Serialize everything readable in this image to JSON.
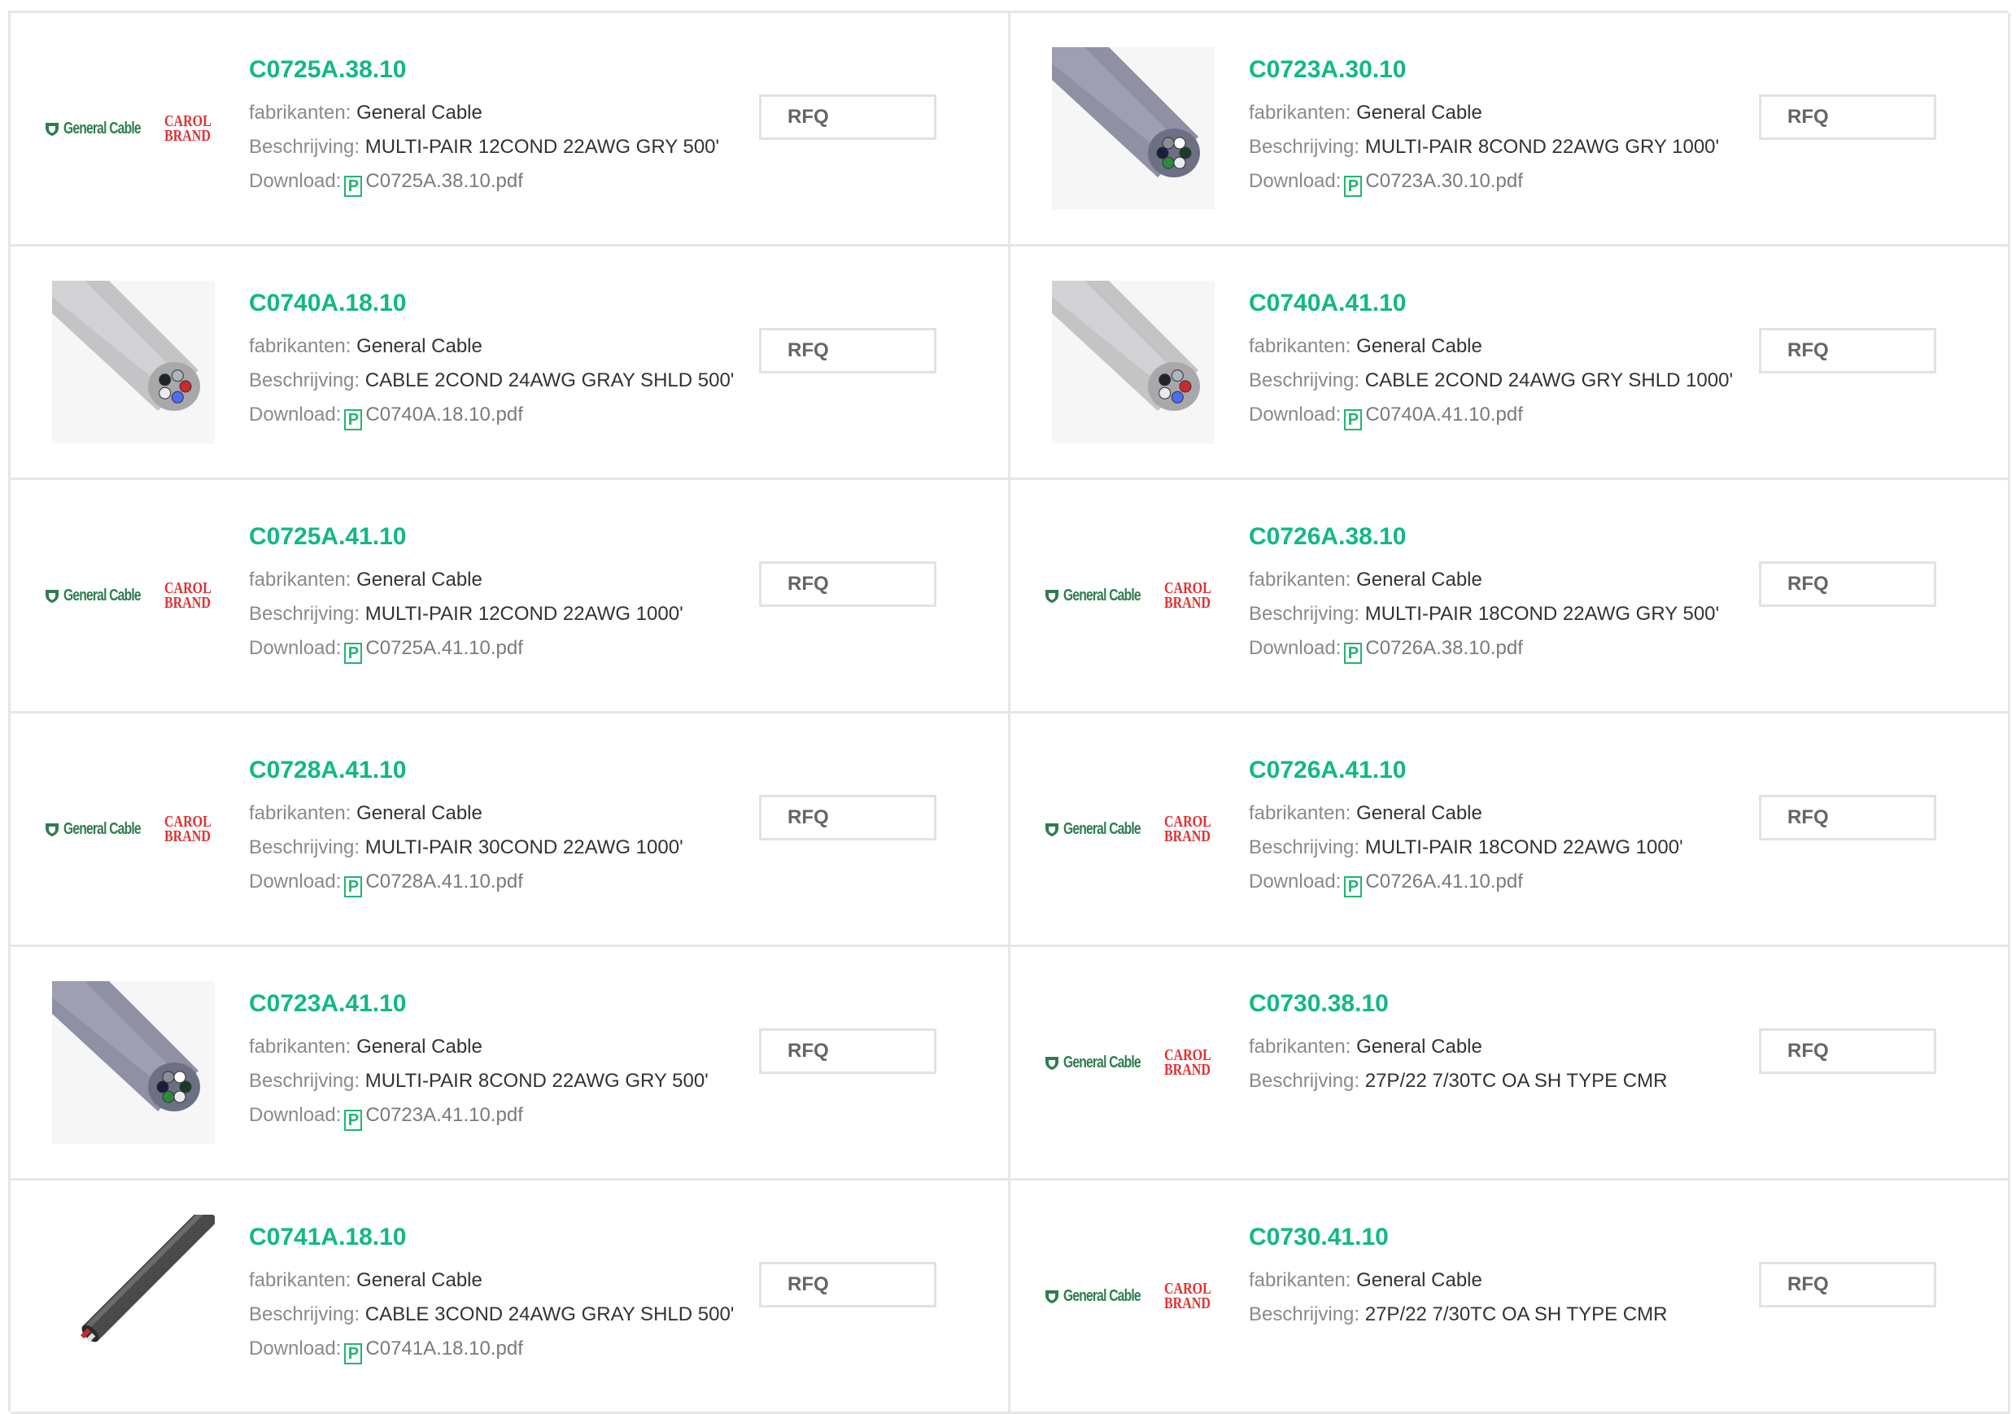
{
  "labels": {
    "manufacturer": "fabrikanten:",
    "description": "Beschrijving:",
    "download": "Download:",
    "rfq": "RFQ",
    "pdf_icon_glyph": "P"
  },
  "logo": {
    "general_cable": "General Cable",
    "carol_line1": "CAROL",
    "carol_line2": "BRAND"
  },
  "colors": {
    "accent": "#12b886",
    "pdf_icon": "#22b573",
    "border": "#e6e6e6",
    "label": "#8a8a8a",
    "value": "#333333",
    "carol_brand": "#e03131",
    "general_cable_brand": "#2e7d4f"
  },
  "products": [
    {
      "part": "C0725A.38.10",
      "manufacturer": "General Cable",
      "description": "MULTI-PAIR 12COND 22AWG GRY 500'",
      "pdf": "C0725A.38.10.pdf",
      "image": "logo"
    },
    {
      "part": "C0723A.30.10",
      "manufacturer": "General Cable",
      "description": "MULTI-PAIR 8COND 22AWG GRY 1000'",
      "pdf": "C0723A.30.10.pdf",
      "image": "cable-purple"
    },
    {
      "part": "C0740A.18.10",
      "manufacturer": "General Cable",
      "description": "CABLE 2COND 24AWG GRAY SHLD 500'",
      "pdf": "C0740A.18.10.pdf",
      "image": "cable-gray"
    },
    {
      "part": "C0740A.41.10",
      "manufacturer": "General Cable",
      "description": "CABLE 2COND 24AWG GRY SHLD 1000'",
      "pdf": "C0740A.41.10.pdf",
      "image": "cable-gray"
    },
    {
      "part": "C0725A.41.10",
      "manufacturer": "General Cable",
      "description": "MULTI-PAIR 12COND 22AWG 1000'",
      "pdf": "C0725A.41.10.pdf",
      "image": "logo"
    },
    {
      "part": "C0726A.38.10",
      "manufacturer": "General Cable",
      "description": "MULTI-PAIR 18COND 22AWG GRY 500'",
      "pdf": "C0726A.38.10.pdf",
      "image": "logo"
    },
    {
      "part": "C0728A.41.10",
      "manufacturer": "General Cable",
      "description": "MULTI-PAIR 30COND 22AWG 1000'",
      "pdf": "C0728A.41.10.pdf",
      "image": "logo"
    },
    {
      "part": "C0726A.41.10",
      "manufacturer": "General Cable",
      "description": "MULTI-PAIR 18COND 22AWG 1000'",
      "pdf": "C0726A.41.10.pdf",
      "image": "logo"
    },
    {
      "part": "C0723A.41.10",
      "manufacturer": "General Cable",
      "description": "MULTI-PAIR 8COND 22AWG GRY 500'",
      "pdf": "C0723A.41.10.pdf",
      "image": "cable-purple"
    },
    {
      "part": "C0730.38.10",
      "manufacturer": "General Cable",
      "description": "27P/22 7/30TC OA SH TYPE CMR",
      "pdf": null,
      "image": "logo"
    },
    {
      "part": "C0741A.18.10",
      "manufacturer": "General Cable",
      "description": "CABLE 3COND 24AWG GRAY SHLD 500'",
      "pdf": "C0741A.18.10.pdf",
      "image": "cable-dark"
    },
    {
      "part": "C0730.41.10",
      "manufacturer": "General Cable",
      "description": "27P/22 7/30TC OA SH TYPE CMR",
      "pdf": null,
      "image": "logo"
    }
  ]
}
